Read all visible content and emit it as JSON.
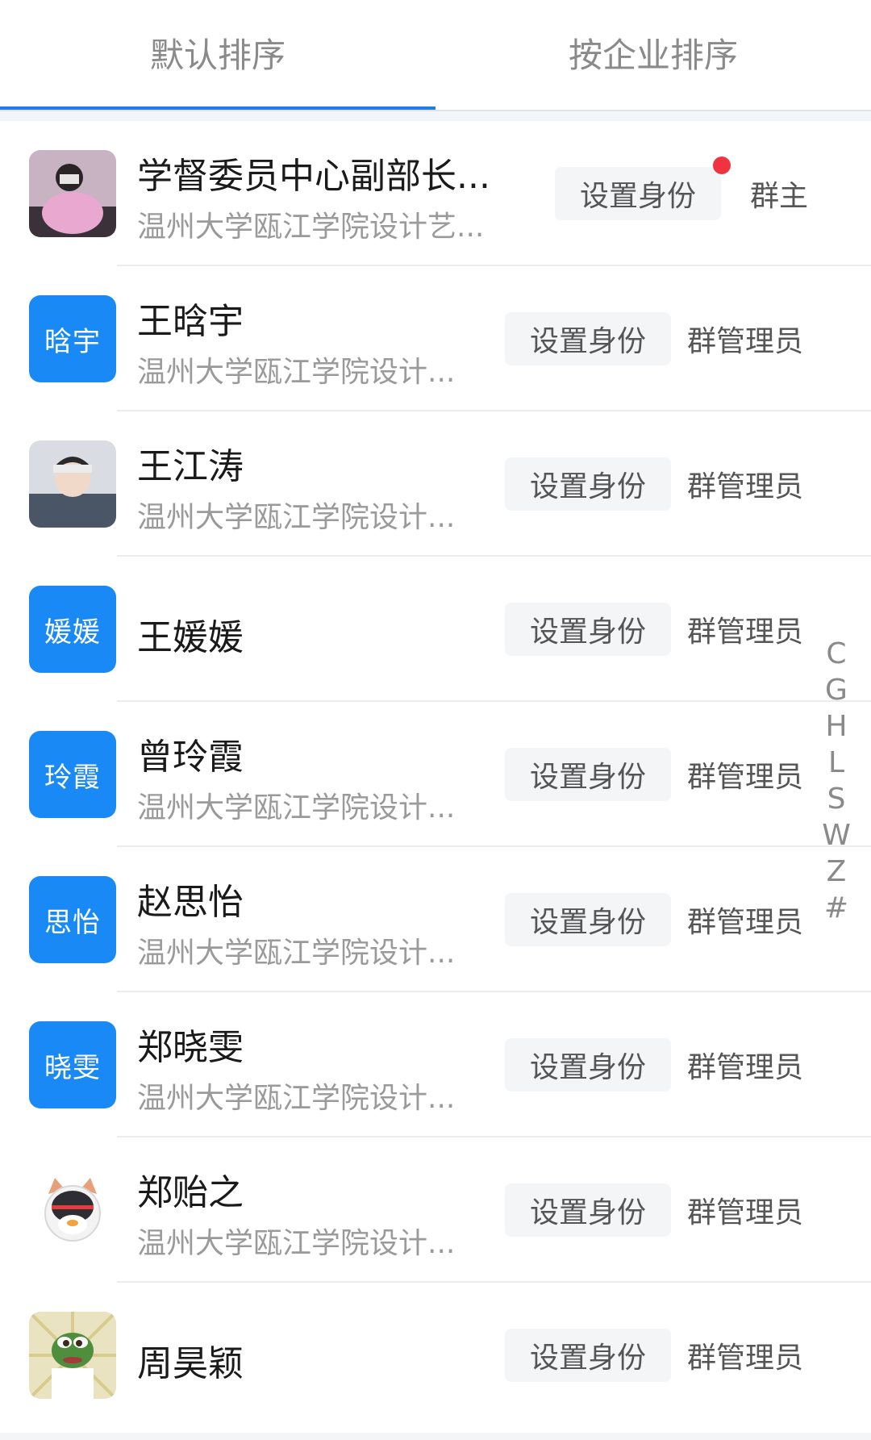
{
  "tabs": [
    {
      "label": "默认排序",
      "active": true
    },
    {
      "label": "按企业排序",
      "active": false
    }
  ],
  "members": [
    {
      "name": "学督委员中心副部长...",
      "subtitle": "温州大学瓯江学院设计艺...",
      "avatar_type": "photo",
      "avatar_desc": "photo-girl-pink",
      "action": "设置身份",
      "role": "群主",
      "badge": true
    },
    {
      "name": "王晗宇",
      "subtitle": "温州大学瓯江学院设计...",
      "avatar_type": "text",
      "avatar_text": "晗宇",
      "action": "设置身份",
      "role": "群管理员"
    },
    {
      "name": "王江涛",
      "subtitle": "温州大学瓯江学院设计...",
      "avatar_type": "photo",
      "avatar_desc": "photo-boy-hat",
      "action": "设置身份",
      "role": "群管理员"
    },
    {
      "name": "王媛媛",
      "subtitle": "",
      "avatar_type": "text",
      "avatar_text": "媛媛",
      "action": "设置身份",
      "role": "群管理员"
    },
    {
      "name": "曾玲霞",
      "subtitle": "温州大学瓯江学院设计...",
      "avatar_type": "text",
      "avatar_text": "玲霞",
      "action": "设置身份",
      "role": "群管理员"
    },
    {
      "name": "赵思怡",
      "subtitle": "温州大学瓯江学院设计...",
      "avatar_type": "text",
      "avatar_text": "思怡",
      "action": "设置身份",
      "role": "群管理员"
    },
    {
      "name": "郑晓雯",
      "subtitle": "温州大学瓯江学院设计...",
      "avatar_type": "text",
      "avatar_text": "晓雯",
      "action": "设置身份",
      "role": "群管理员"
    },
    {
      "name": "郑贻之",
      "subtitle": "温州大学瓯江学院设计...",
      "avatar_type": "photo",
      "avatar_desc": "sticker-penguin-cat",
      "action": "设置身份",
      "role": "群管理员"
    },
    {
      "name": "周昊颖",
      "subtitle": "",
      "avatar_type": "photo",
      "avatar_desc": "sticker-frog",
      "action": "设置身份",
      "role": "群管理员"
    }
  ],
  "index_letters": [
    "C",
    "G",
    "H",
    "L",
    "S",
    "W",
    "Z",
    "#"
  ],
  "colors": {
    "accent": "#1d7fe5",
    "avatar_blue": "#1989f5",
    "badge_red": "#f0343f"
  }
}
